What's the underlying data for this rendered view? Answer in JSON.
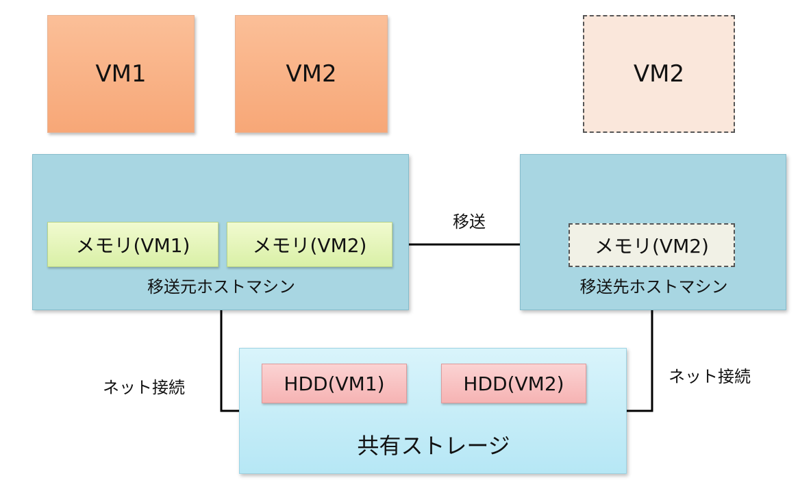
{
  "vms": {
    "vm1": "VM1",
    "vm2": "VM2",
    "vm2_destination": "VM2"
  },
  "source_host": {
    "label": "移送元ホストマシン",
    "memory": [
      "メモリ(VM1)",
      "メモリ(VM2)"
    ]
  },
  "destination_host": {
    "label": "移送先ホストマシン",
    "memory": "メモリ(VM2)"
  },
  "transfer_label": "移送",
  "network": {
    "left_label": "ネット接続",
    "right_label": "ネット接続"
  },
  "shared_storage": {
    "label": "共有ストレージ",
    "disks": [
      "HDD(VM1)",
      "HDD(VM2)"
    ]
  },
  "colors": {
    "vm": "#f7a777",
    "vm_ghost": "#fae7db",
    "host": "#a8d6e2",
    "memory": "#d9f0a6",
    "storage": "#b6e7f5",
    "hdd": "#f6b3b3"
  }
}
